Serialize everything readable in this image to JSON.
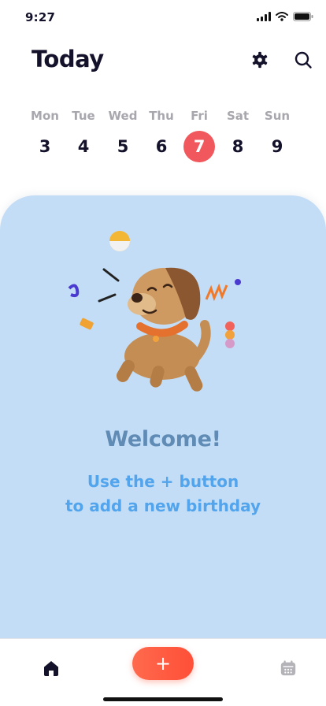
{
  "status_bar": {
    "time": "9:27"
  },
  "header": {
    "title": "Today",
    "settings_icon": "gear-icon",
    "search_icon": "search-icon"
  },
  "week": {
    "days": [
      {
        "name": "Mon",
        "num": "3"
      },
      {
        "name": "Tue",
        "num": "4"
      },
      {
        "name": "Wed",
        "num": "5"
      },
      {
        "name": "Thu",
        "num": "6"
      },
      {
        "name": "Fri",
        "num": "7"
      },
      {
        "name": "Sat",
        "num": "8"
      },
      {
        "name": "Sun",
        "num": "9"
      }
    ],
    "selected_day": "7",
    "selected_color": "#f0585d"
  },
  "empty_state": {
    "title": "Welcome!",
    "subtitle_line1": "Use the + button",
    "subtitle_line2": "to add a new birthday",
    "background": "#c3ddf6",
    "illustration": "happy-puppy-illustration"
  },
  "tab_bar": {
    "home_icon": "home-icon",
    "add_label": "+",
    "calendar_icon": "calendar-icon",
    "accent": "#ff5a42"
  }
}
